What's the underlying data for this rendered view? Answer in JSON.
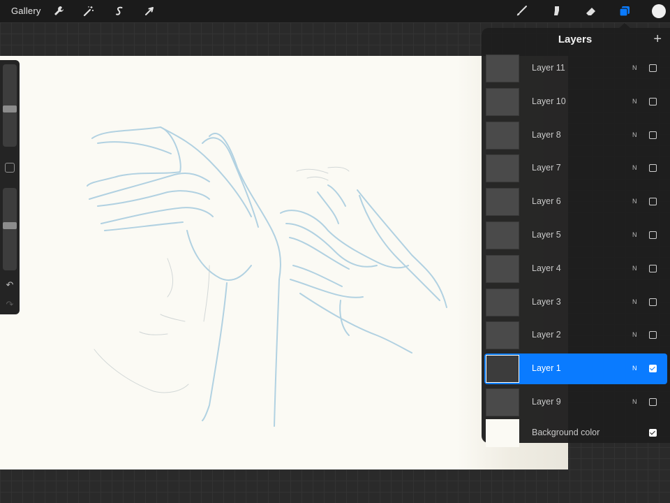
{
  "toolbar": {
    "gallery_label": "Gallery",
    "left_icons": [
      "wrench-icon",
      "magic-wand-icon",
      "selection-s-icon",
      "transform-arrow-icon"
    ],
    "right_icons": [
      "brush-icon",
      "smudge-icon",
      "eraser-icon",
      "layers-icon"
    ],
    "active_tool": "layers-icon",
    "accent_color": "#0a7bff",
    "current_color": "#f0f0f0"
  },
  "sidebar": {
    "brush_size_level": 0.45,
    "opacity_level": 0.55,
    "icons": [
      "modify-square-icon",
      "undo-arrow-icon",
      "redo-arrow-icon"
    ]
  },
  "layers_panel": {
    "title": "Layers",
    "add_icon": "+",
    "layers": [
      {
        "name": "Layer 11",
        "blend": "N",
        "visible": false,
        "selected": false
      },
      {
        "name": "Layer 10",
        "blend": "N",
        "visible": false,
        "selected": false
      },
      {
        "name": "Layer 8",
        "blend": "N",
        "visible": false,
        "selected": false
      },
      {
        "name": "Layer 7",
        "blend": "N",
        "visible": false,
        "selected": false
      },
      {
        "name": "Layer 6",
        "blend": "N",
        "visible": false,
        "selected": false
      },
      {
        "name": "Layer 5",
        "blend": "N",
        "visible": false,
        "selected": false
      },
      {
        "name": "Layer 4",
        "blend": "N",
        "visible": false,
        "selected": false
      },
      {
        "name": "Layer 3",
        "blend": "N",
        "visible": false,
        "selected": false
      },
      {
        "name": "Layer 2",
        "blend": "N",
        "visible": false,
        "selected": false
      },
      {
        "name": "Layer 1",
        "blend": "N",
        "visible": true,
        "selected": true
      },
      {
        "name": "Layer 9",
        "blend": "N",
        "visible": false,
        "selected": false
      }
    ],
    "background": {
      "name": "Background color",
      "visible": true
    }
  },
  "canvas": {
    "sketch_color": "#9fc4da",
    "paper_color": "#fbfaf4"
  }
}
